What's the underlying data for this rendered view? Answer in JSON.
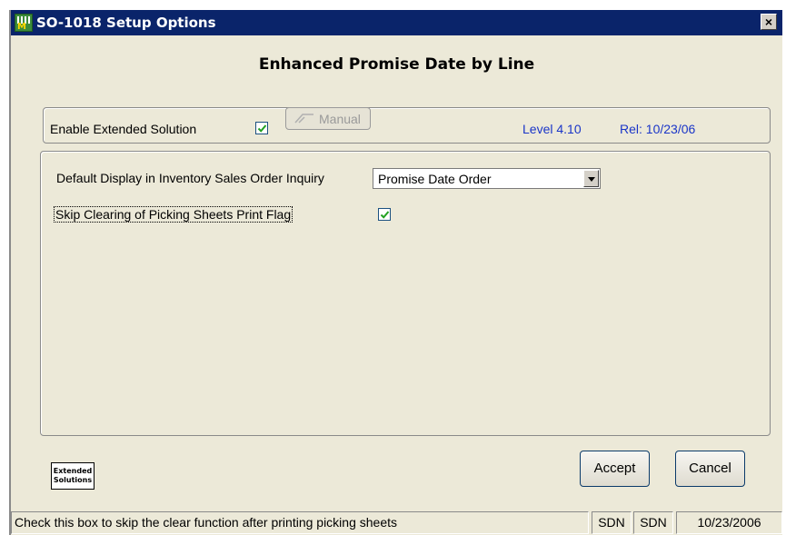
{
  "window": {
    "title": "SO-1018  Setup Options",
    "app_icon": "mas90-icon",
    "close_label": "×"
  },
  "heading": "Enhanced Promise Date by Line",
  "top_panel": {
    "enable_label": "Enable Extended Solution",
    "enable_checked": true,
    "manual_button": "Manual",
    "level": "Level 4.10",
    "release": "Rel: 10/23/06"
  },
  "options": {
    "default_display_label": "Default Display in Inventory Sales Order Inquiry",
    "default_display_value": "Promise Date Order",
    "skip_clearing_label": "Skip Clearing of Picking Sheets Print Flag",
    "skip_clearing_checked": true
  },
  "logo": {
    "line1": "Extended",
    "line2": "Solutions"
  },
  "buttons": {
    "accept": "Accept",
    "cancel": "Cancel"
  },
  "status_bar": {
    "message": "Check this box to skip the clear function after printing picking sheets",
    "company1": "SDN",
    "company2": "SDN",
    "date": "10/23/2006"
  },
  "colors": {
    "title_bar": "#0a246a",
    "accent_text": "#1a35c8",
    "checkmark": "#21a121"
  }
}
